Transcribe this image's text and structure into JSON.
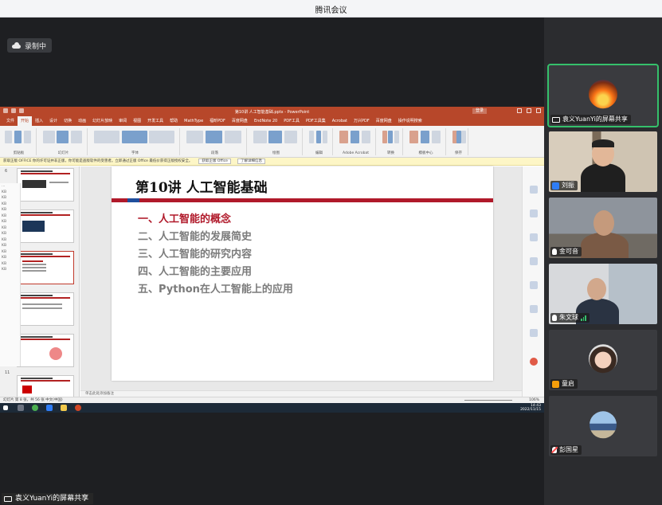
{
  "app": {
    "title": "腾讯会议",
    "recording_label": "录制中"
  },
  "share_owner_label": "袁义YuanYi的屏幕共享",
  "ppt": {
    "document_title": "第10讲 人工智能基础.pptx - PowerPoint",
    "login_label": "登录",
    "tabs": [
      "文件",
      "开始",
      "插入",
      "设计",
      "切换",
      "动画",
      "幻灯片放映",
      "审阅",
      "视图",
      "开发工具",
      "帮助",
      "MathType",
      "福昕PDF",
      "百度网盘",
      "EndNote 20",
      "PDF工具",
      "PDF工具集",
      "Acrobat",
      "万兴PDF",
      "百度网盘",
      "操作说明搜索"
    ],
    "active_tab": "开始",
    "ribbon_groups": [
      "剪贴板",
      "幻灯片",
      "字体",
      "段落",
      "绘图",
      "编辑",
      "Adobe Acrobat",
      "转换",
      "模板中心",
      "保存"
    ],
    "notice_text": "获取正版 OFFICE  你的许可证并非正版，你可能是盗版软件的受害者。立即通过正版 Office 最低价获得正版授权安全。",
    "notice_buttons": [
      "获取正版 Office",
      "了解详细信息"
    ],
    "slide": {
      "title": "第10讲  人工智能基础",
      "items": [
        {
          "text": "一、人工智能的概念",
          "active": true
        },
        {
          "text": "二、人工智能的发展简史",
          "active": false
        },
        {
          "text": "三、人工智能的研究内容",
          "active": false
        },
        {
          "text": "四、人工智能的主要应用",
          "active": false
        },
        {
          "text": "五、Python在人工智能上的应用",
          "active": false
        }
      ]
    },
    "notes_placeholder": "单击此处添加备注",
    "thumb_numbers": [
      "6",
      "11"
    ],
    "status_left": "幻灯片 第 8 张，共 56 张   中文(中国)",
    "status_right": "106%",
    "taskbar_time": "14:43",
    "taskbar_date": "2022/11/15"
  },
  "participants": [
    {
      "name": "袁义YuanYi的屏幕共享",
      "icon": "screen-share-icon",
      "active": true
    },
    {
      "name": "刘振",
      "icon": "user-icon"
    },
    {
      "name": "金可音",
      "icon": "mic-icon"
    },
    {
      "name": "朱文球",
      "icon": "mic-icon"
    },
    {
      "name": "童启",
      "icon": "user-icon"
    },
    {
      "name": "彭国星",
      "icon": "mic-muted-icon"
    }
  ],
  "colors": {
    "accent_green": "#35c06b",
    "ppt_red": "#b7472a",
    "slide_red": "#b0192a"
  }
}
